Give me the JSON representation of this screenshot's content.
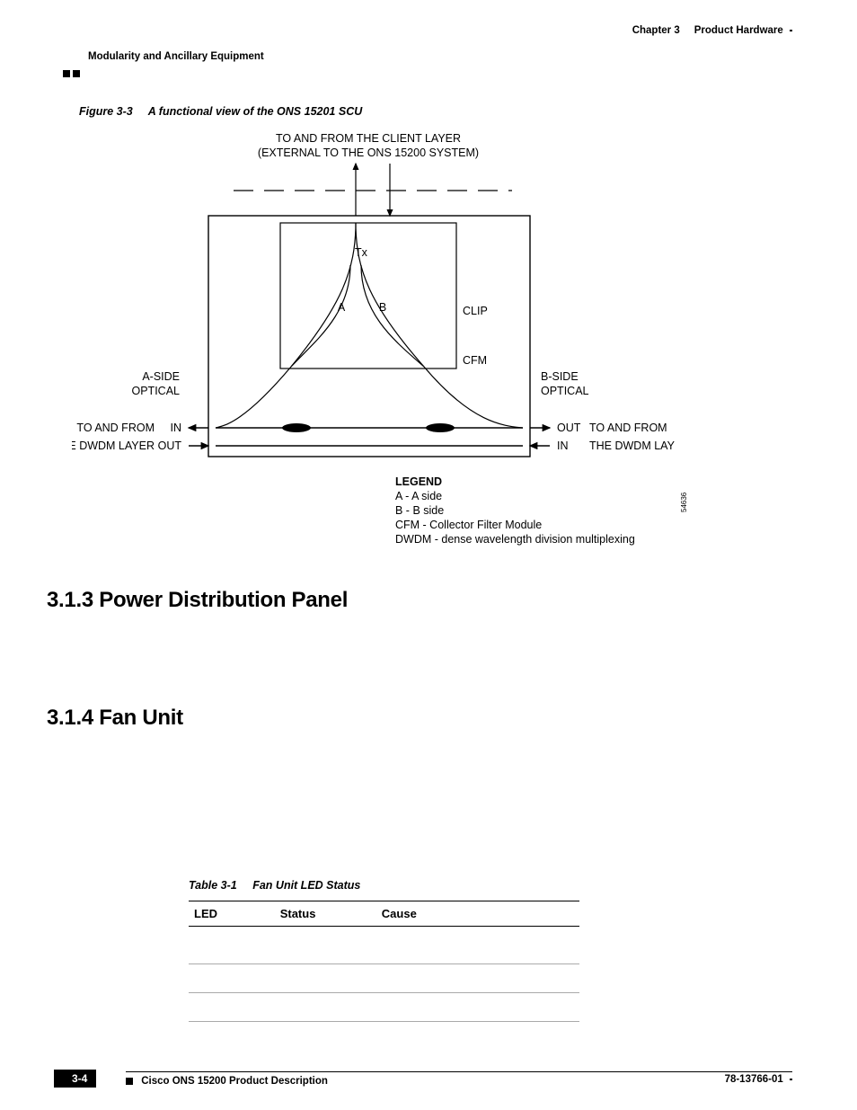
{
  "header": {
    "chapter_label": "Chapter 3",
    "chapter_title": "Product Hardware",
    "section_title": "Modularity and Ancillary Equipment"
  },
  "figure": {
    "label": "Figure 3-3",
    "caption": "A functional view of the ONS 15201 SCU",
    "top_line1": "TO AND FROM THE CLIENT LAYER",
    "top_line2": "(EXTERNAL TO THE ONS 15200 SYSTEM)",
    "tx": "Tx",
    "A": "A",
    "B": "B",
    "clip": "CLIP",
    "cfm": "CFM",
    "a_side1": "A-SIDE",
    "a_side2": "OPTICAL",
    "a_in": "IN",
    "a_out": "OUT",
    "a_to1": "TO AND FROM",
    "a_to2": "THE DWDM LAYER",
    "b_side1": "B-SIDE",
    "b_side2": "OPTICAL",
    "b_out": "OUT",
    "b_in": "IN",
    "b_to1": "TO AND FROM",
    "b_to2": "THE DWDM LAY",
    "legend_title": "LEGEND",
    "legend_a": "A - A side",
    "legend_b": "B - B side",
    "legend_cfm": "CFM - Collector Filter Module",
    "legend_dwdm": "DWDM - dense wavelength division multiplexing",
    "figno": "54636"
  },
  "sections": {
    "s313": "3.1.3  Power Distribution Panel",
    "s314": "3.1.4  Fan Unit"
  },
  "table": {
    "label": "Table 3-1",
    "caption": "Fan Unit LED Status",
    "headers": {
      "c1": "LED",
      "c2": "Status",
      "c3": "Cause"
    },
    "rows": [
      {
        "c1": "",
        "c2": "",
        "c3": ""
      },
      {
        "c1": "",
        "c2": "",
        "c3": ""
      },
      {
        "c1": "",
        "c2": "",
        "c3": ""
      }
    ]
  },
  "footer": {
    "book": "Cisco ONS 15200 Product Description",
    "page": "3-4",
    "docnum": "78-13766-01"
  }
}
